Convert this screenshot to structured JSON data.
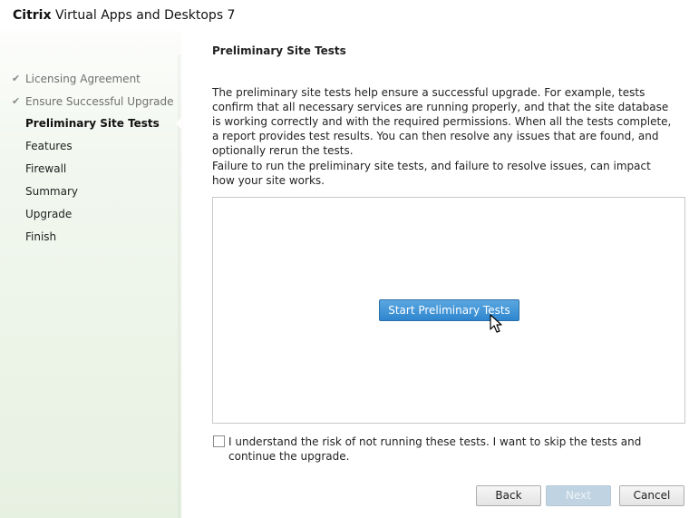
{
  "window": {
    "brand": "Citrix",
    "title_rest": "Virtual Apps and Desktops 7"
  },
  "sidebar": {
    "items": [
      {
        "label": "Licensing Agreement",
        "state": "done"
      },
      {
        "label": "Ensure Successful Upgrade",
        "state": "done"
      },
      {
        "label": "Preliminary Site Tests",
        "state": "current"
      },
      {
        "label": "Features",
        "state": "pending"
      },
      {
        "label": "Firewall",
        "state": "pending"
      },
      {
        "label": "Summary",
        "state": "pending"
      },
      {
        "label": "Upgrade",
        "state": "pending"
      },
      {
        "label": "Finish",
        "state": "pending"
      }
    ]
  },
  "main": {
    "title": "Preliminary Site Tests",
    "intro": "The preliminary site tests help ensure a successful upgrade. For example, tests confirm that all necessary services are running properly, and that the site database is working correctly and with the required permissions. When all the tests complete, a report provides test results. You can then resolve any issues that are found, and optionally rerun the tests.",
    "warning": "Failure to run the preliminary site tests, and failure to resolve issues, can impact how your site works.",
    "start_button": "Start Preliminary Tests",
    "skip_checkbox": {
      "label": "I understand the risk of not running these tests. I want to skip the tests and continue the upgrade.",
      "checked": false
    }
  },
  "footer": {
    "back": "Back",
    "next": "Next",
    "cancel": "Cancel"
  },
  "colors": {
    "accent": "#2f86cf",
    "sidebar_bg": "#e7f1e2"
  }
}
